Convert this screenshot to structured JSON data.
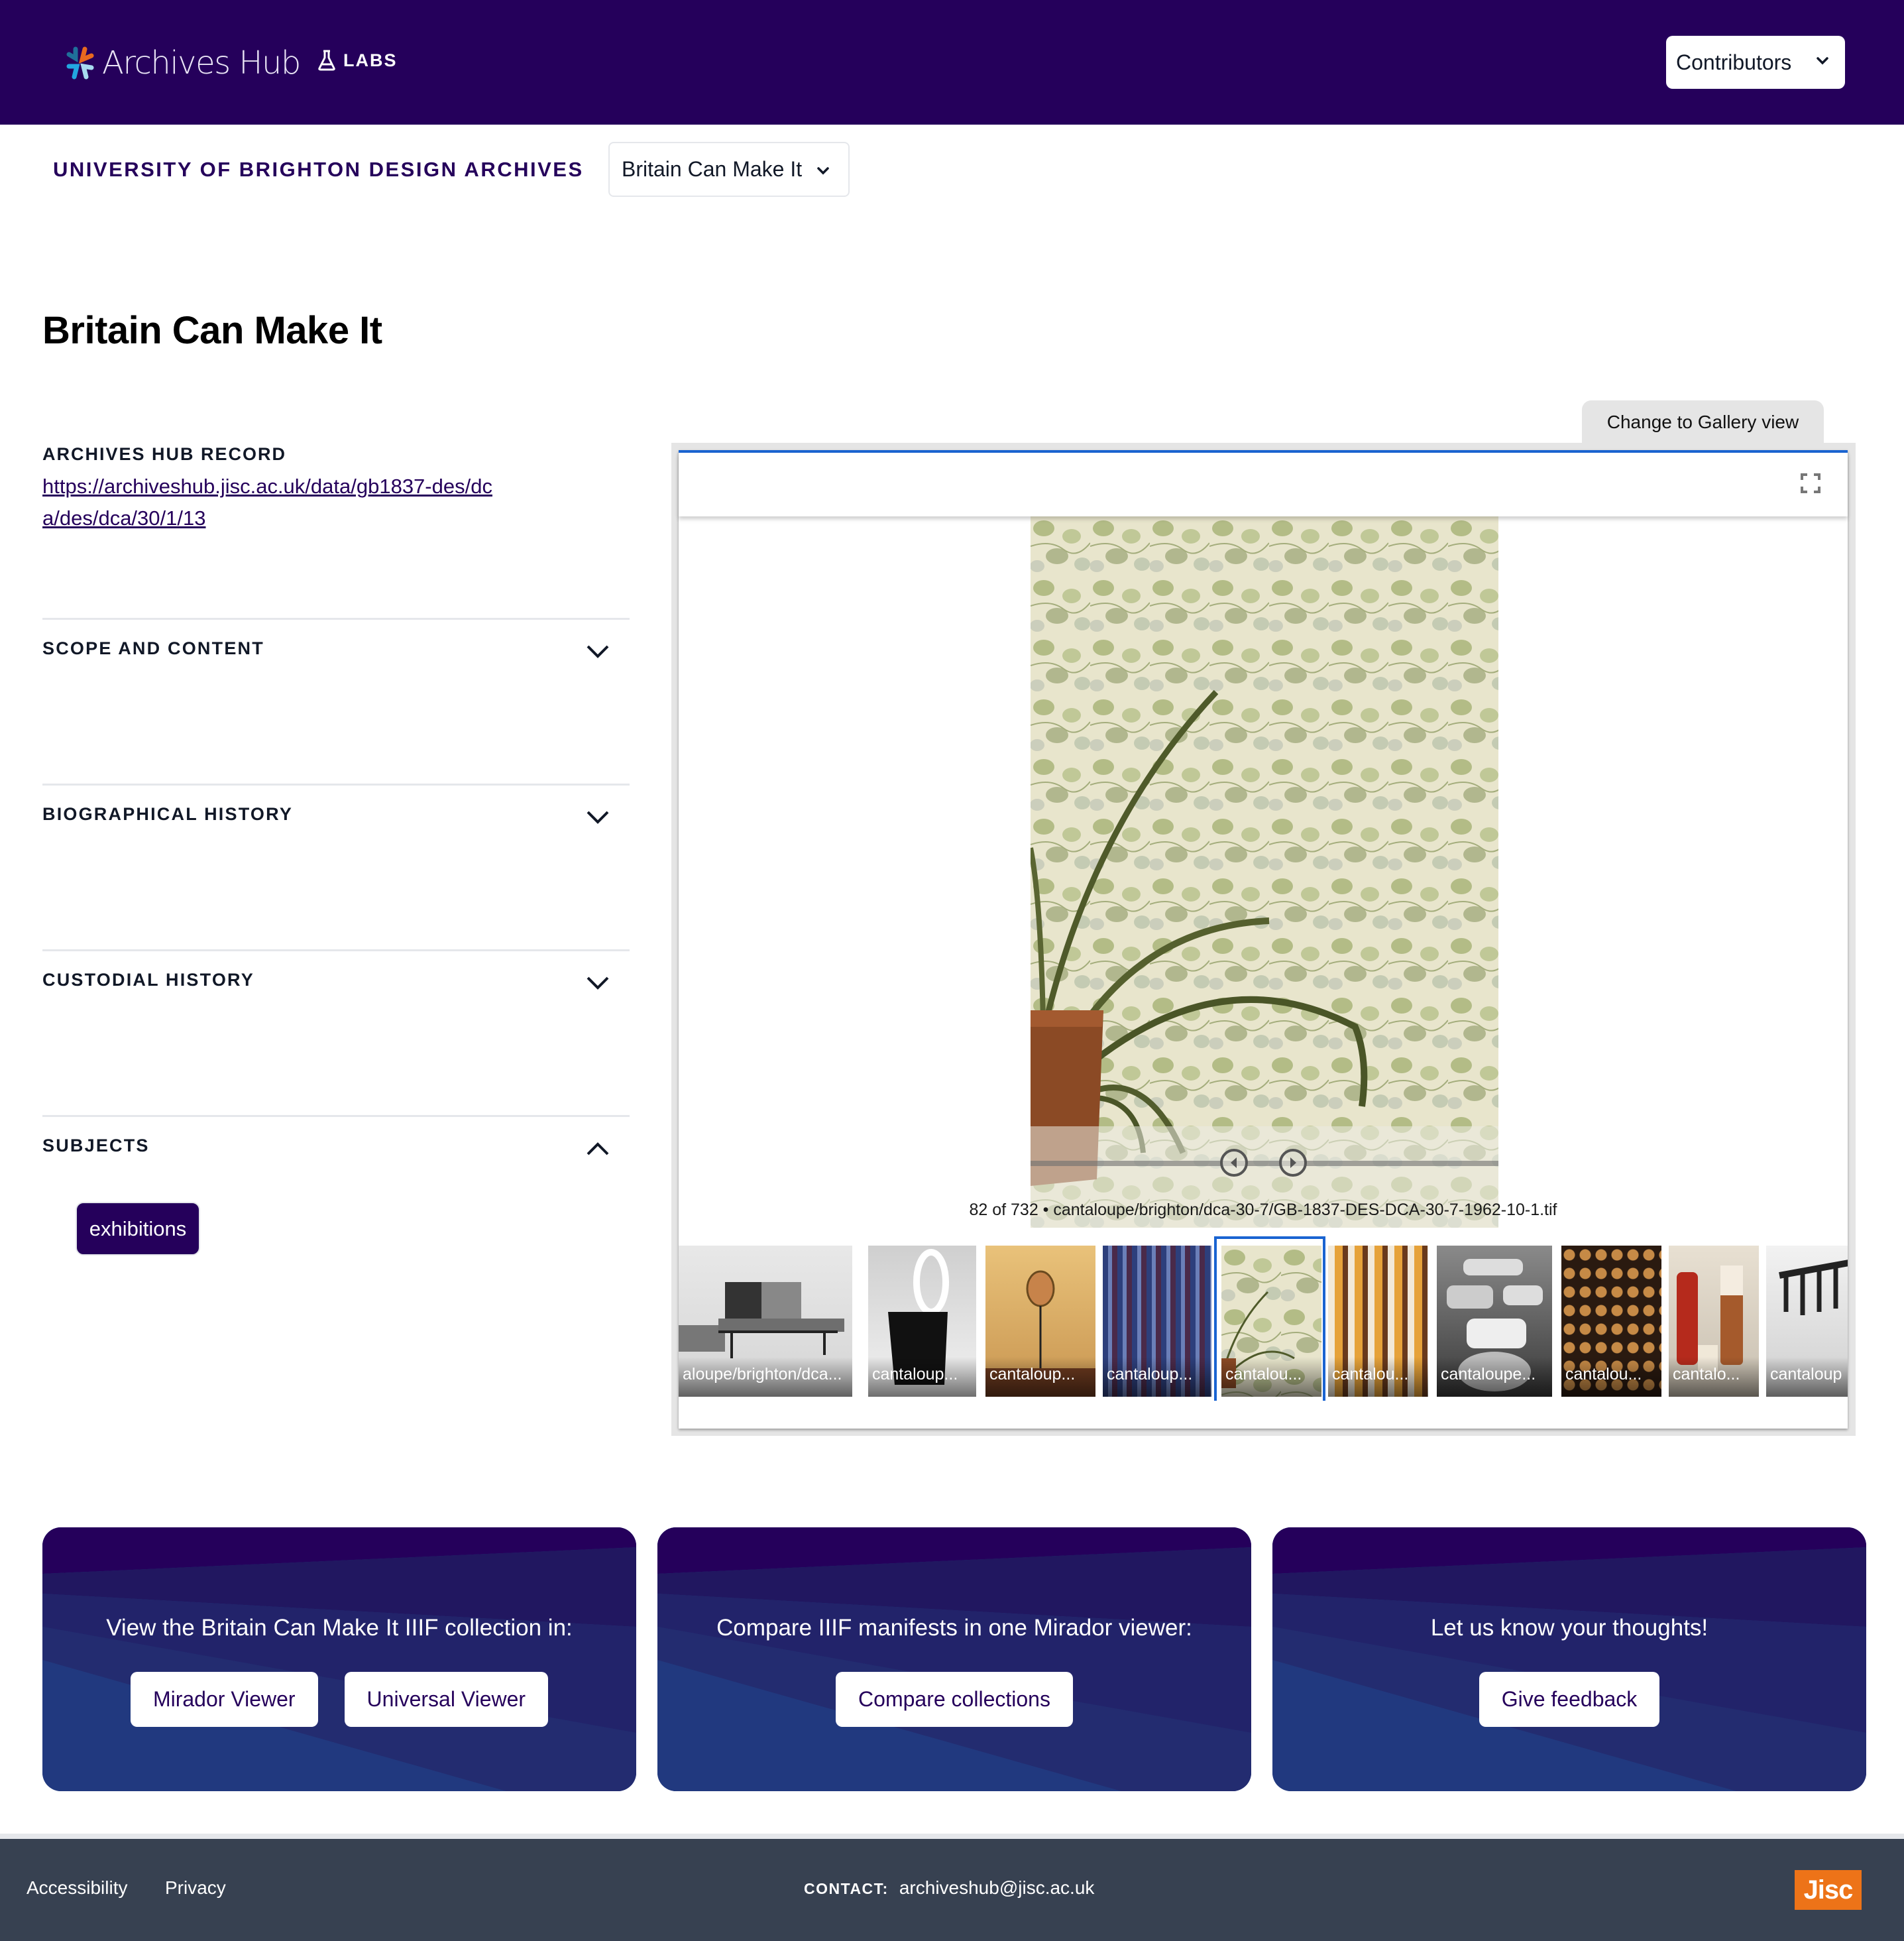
{
  "header": {
    "brand": "Archives Hub",
    "labs_label": "LABS",
    "contributors_label": "Contributors",
    "brand_color": "#25005b"
  },
  "subheader": {
    "organisation": "UNIVERSITY OF BRIGHTON DESIGN ARCHIVES",
    "collection_selected": "Britain Can Make It"
  },
  "page": {
    "title": "Britain Can Make It"
  },
  "record": {
    "label": "ARCHIVES HUB RECORD",
    "link": "https://archiveshub.jisc.ac.uk/data/gb1837-des/dca/des/dca/30/1/13"
  },
  "accordions": [
    {
      "title": "SCOPE AND CONTENT",
      "expanded": false
    },
    {
      "title": "BIOGRAPHICAL HISTORY",
      "expanded": false
    },
    {
      "title": "CUSTODIAL HISTORY",
      "expanded": false
    },
    {
      "title": "SUBJECTS",
      "expanded": true
    }
  ],
  "subjects": [
    "exhibitions"
  ],
  "viewer": {
    "gallery_toggle_label": "Change to Gallery view",
    "caption": "82 of 732 • cantaloupe/brighton/dca-30-7/GB-1837-DES-DCA-30-7-1962-10-1.tif",
    "current_index": 82,
    "total": 732,
    "accent_color": "#1a64d1",
    "thumbnails": [
      {
        "label": "aloupe/brighton/dca...",
        "subject": "sofa-unit"
      },
      {
        "label": "cantaloup...",
        "subject": "pedal-bin"
      },
      {
        "label": "cantaloup...",
        "subject": "mirror-on-stand"
      },
      {
        "label": "cantaloup...",
        "subject": "curtains"
      },
      {
        "label": "cantalou...",
        "subject": "leaf-wallpaper-plant",
        "selected": true
      },
      {
        "label": "cantalou...",
        "subject": "sunflower-fabric"
      },
      {
        "label": "cantaloupe...",
        "subject": "steel-trays"
      },
      {
        "label": "cantalou...",
        "subject": "tile-wall"
      },
      {
        "label": "cantalo...",
        "subject": "flasks"
      },
      {
        "label": "cantaloup",
        "subject": "rake"
      }
    ]
  },
  "promos": [
    {
      "text": "View the Britain Can Make It IIIF collection in:",
      "buttons": [
        "Mirador Viewer",
        "Universal Viewer"
      ]
    },
    {
      "text": "Compare IIIF manifests in one Mirador viewer:",
      "buttons": [
        "Compare collections"
      ]
    },
    {
      "text": "Let us know your thoughts!",
      "buttons": [
        "Give feedback"
      ]
    }
  ],
  "footer": {
    "links": [
      "Accessibility",
      "Privacy"
    ],
    "contact_label": "CONTACT:",
    "contact_email": "archiveshub@jisc.ac.uk",
    "jisc_logo": "Jisc",
    "jisc_color": "#ed7318"
  }
}
